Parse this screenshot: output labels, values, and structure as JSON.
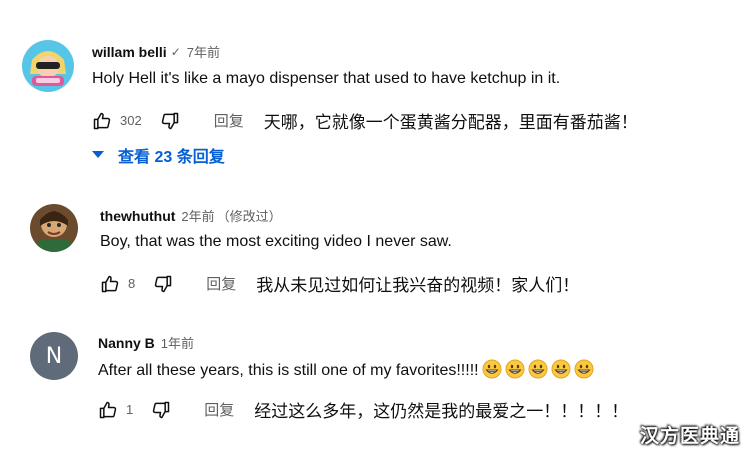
{
  "comments": [
    {
      "author": "willam belli",
      "verified_icon": "check-icon",
      "time": "7年前",
      "text": "Holy Hell it's like a mayo dispenser that used to have ketchup in it.",
      "likes": "302",
      "reply_label": "回复",
      "translation": "天哪，它就像一个蛋黄酱分配器，里面有番茄酱！",
      "replies_toggle": "查看 23 条回复"
    },
    {
      "author": "thewhuthut",
      "time": "2年前",
      "edited": "（修改过）",
      "text": "Boy, that was the most exciting video I never saw.",
      "likes": "8",
      "reply_label": "回复",
      "translation": "我从未见过如何让我兴奋的视频！家人们！"
    },
    {
      "author": "Nanny B",
      "avatar_letter": "N",
      "time": "1年前",
      "text": "After all these years, this is still one of my favorites!!!!!",
      "emoji_count": 5,
      "emoji_name": "grinning-face-emoji",
      "likes": "1",
      "reply_label": "回复",
      "translation": "经过这么多年，这仍然是我的最爱之一！！！！！"
    }
  ],
  "watermark": "汉方医典通",
  "colors": {
    "link_blue": "#065fd4",
    "secondary_text": "#606060",
    "avatar_gray": "#5f6b78"
  }
}
